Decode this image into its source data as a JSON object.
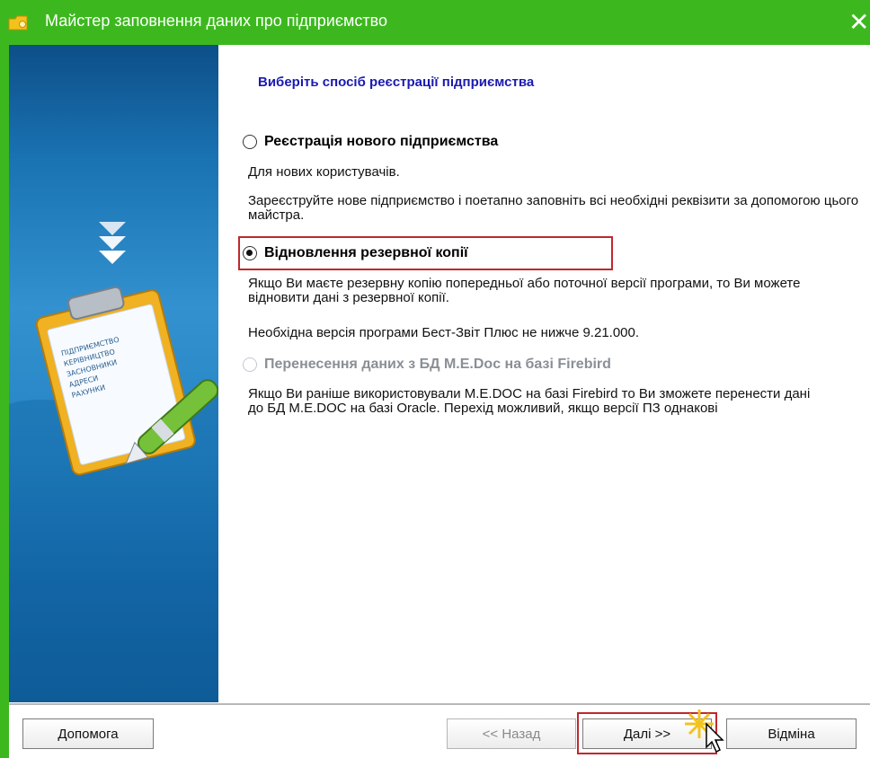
{
  "window": {
    "title": "Майстер заповнення даних про підприємство"
  },
  "icons": {
    "app": "folder-key-icon",
    "close": "close-icon",
    "side": "clipboard-pen-icon"
  },
  "side_panel": {
    "clipboard_lines": [
      "ПІДПРИЄМСТВО",
      "КЕРІВНИЦТВО",
      "ЗАСНОВНИКИ",
      "АДРЕСИ",
      "РАХУНКИ"
    ]
  },
  "content": {
    "heading": "Виберіть спосіб реєстрації підприємства",
    "options": [
      {
        "label": "Реєстрація нового підприємства",
        "checked": false,
        "enabled": true,
        "descriptions": [
          "Для нових користувачів.",
          "Зареєструйте нове підприємство і поетапно заповніть всі необхідні реквізити за допомогою цього майстра."
        ]
      },
      {
        "label": "Відновлення резервної копії",
        "checked": true,
        "enabled": true,
        "descriptions": [
          "Якщо Ви маєте резервну копію попередньої або поточної версії програми, то Ви можете відновити дані з резервної копії.",
          "Необхідна версія програми Бест-Звіт Плюс не нижче 9.21.000."
        ]
      },
      {
        "label": "Перенесення даних з БД M.E.Doc на базі Firebird",
        "checked": false,
        "enabled": false,
        "descriptions": [
          "Якщо Ви раніше використовували M.E.DOC на базі Firebird то Ви зможете перенести дані до БД M.E.DOC на базі Oracle. Перехід можливий, якщо версії ПЗ однакові"
        ]
      }
    ]
  },
  "buttons": {
    "help": "Допомога",
    "back": "<< Назад",
    "next": "Далі >>",
    "cancel": "Відміна"
  },
  "colors": {
    "title_bar": "#3cb81e",
    "heading": "#1a1ab0",
    "highlight": "#c0282d"
  }
}
